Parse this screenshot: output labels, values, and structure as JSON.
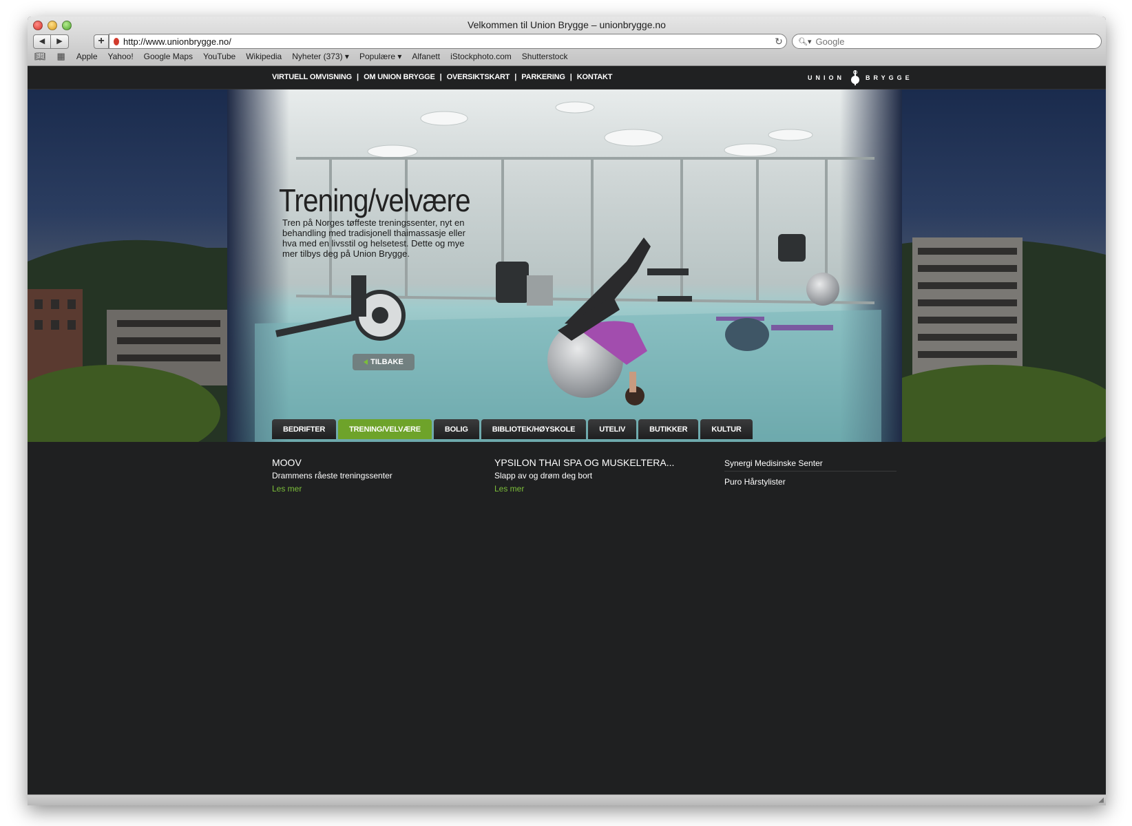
{
  "browser": {
    "title": "Velkommen til Union Brygge – unionbrygge.no",
    "url": "http://www.unionbrygge.no/",
    "search_placeholder": "Google",
    "bookmarks": [
      "Apple",
      "Yahoo!",
      "Google Maps",
      "YouTube",
      "Wikipedia",
      "Nyheter (373) ▾",
      "Populære ▾",
      "Alfanett",
      "iStockphoto.com",
      "Shutterstock"
    ]
  },
  "topnav": {
    "links": [
      "VIRTUELL OMVISNING",
      "OM UNION BRYGGE",
      "OVERSIKTSKART",
      "PARKERING",
      "KONTAKT"
    ],
    "logo_left": "UNION",
    "logo_right": "BRYGGE"
  },
  "hero": {
    "title": "Trening/velvære",
    "text": "Tren på Norges tøffeste treningssenter, nyt en behandling med tradisjonell thaimassasje eller hva med en livsstil og helsetest. Dette og mye mer tilbys deg på Union Brygge.",
    "back_label": "TILBAKE"
  },
  "tabs": [
    {
      "label": "BEDRIFTER",
      "active": false
    },
    {
      "label": "TRENING/VELVÆRE",
      "active": true
    },
    {
      "label": "BOLIG",
      "active": false
    },
    {
      "label": "BIBLIOTEK/HØYSKOLE",
      "active": false
    },
    {
      "label": "UTELIV",
      "active": false
    },
    {
      "label": "BUTIKKER",
      "active": false
    },
    {
      "label": "KULTUR",
      "active": false
    }
  ],
  "content": {
    "col1": {
      "title": "MOOV",
      "sub": "Drammens råeste treningssenter",
      "more": "Les mer"
    },
    "col2": {
      "title": "YPSILON THAI SPA OG MUSKELTERA...",
      "sub": "Slapp av og drøm deg bort",
      "more": "Les mer"
    },
    "list": [
      "Synergi Medisinske Senter",
      "Puro Hårstylister"
    ]
  },
  "colors": {
    "accent": "#6ea32a",
    "link": "#7cbf3a",
    "background": "#1f2021"
  }
}
